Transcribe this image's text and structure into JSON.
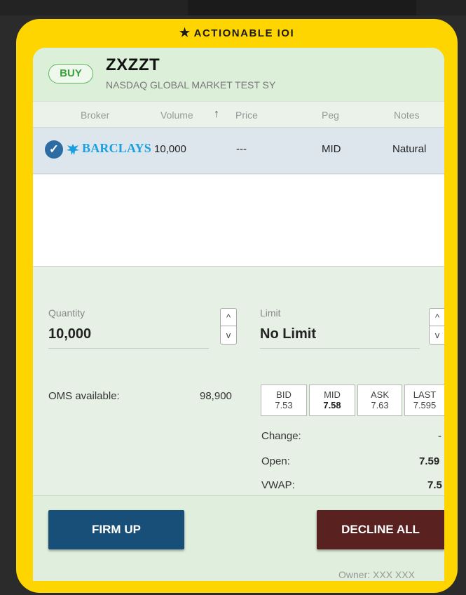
{
  "banner": {
    "star": "★",
    "title": "ACTIONABLE IOI"
  },
  "ioi": {
    "side": "BUY",
    "symbol": "ZXZZT",
    "exchange": "NASDAQ GLOBAL MARKET TEST SY"
  },
  "table": {
    "columns": {
      "broker": "Broker",
      "volume": "Volume",
      "sort_arrow": "↑",
      "price": "Price",
      "peg": "Peg",
      "notes": "Notes"
    },
    "rows": [
      {
        "check": "✓",
        "broker": "BARCLAYS",
        "volume": "10,000",
        "price": "---",
        "peg": "MID",
        "notes": "Natural"
      }
    ]
  },
  "order": {
    "quantity_label": "Quantity",
    "quantity_value": "10,000",
    "limit_label": "Limit",
    "limit_value": "No Limit",
    "step_up": "^",
    "step_down": "v"
  },
  "oms": {
    "label": "OMS available:",
    "value": "98,900"
  },
  "quotes": {
    "bid_label": "BID",
    "bid_value": "7.53",
    "mid_label": "MID",
    "mid_value": "7.58",
    "ask_label": "ASK",
    "ask_value": "7.63",
    "last_label": "LAST",
    "last_value": "7.595"
  },
  "stats": {
    "change_label": "Change:",
    "change_value": "-",
    "open_label": "Open:",
    "open_value": "7.59",
    "vwap_label": "VWAP:",
    "vwap_value": "7.5"
  },
  "actions": {
    "firm_up": "FIRM UP",
    "decline_all": "DECLINE ALL"
  },
  "owner": "Owner: XXX XXX",
  "colors": {
    "frame": "#ffd500",
    "buy": "#3aa13a",
    "firm_up": "#184f78",
    "decline": "#5a2121",
    "broker_brand": "#1aa0e0"
  }
}
